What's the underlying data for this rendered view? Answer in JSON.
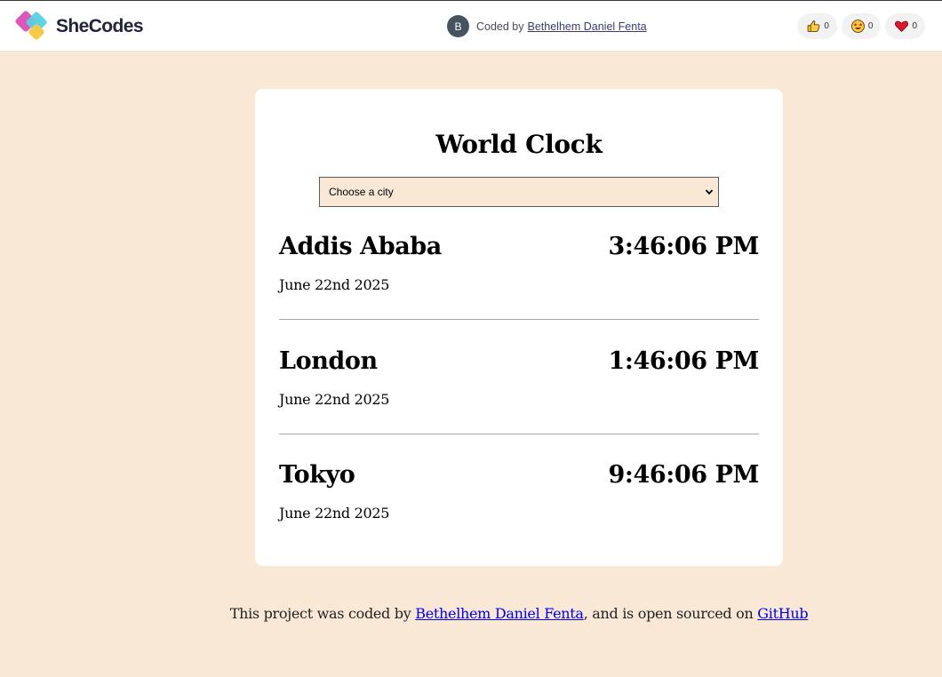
{
  "topbar": {
    "brand": "SheCodes",
    "credit": {
      "avatar_initial": "B",
      "prefix": "Coded by",
      "author": "Bethelhem Daniel Fenta"
    },
    "reactions": [
      {
        "icon": "thumbs-up-icon",
        "count": "0"
      },
      {
        "icon": "star-struck-icon",
        "count": "0"
      },
      {
        "icon": "heart-icon",
        "count": "0"
      }
    ]
  },
  "app": {
    "title": "World Clock",
    "select": {
      "selected": "Choose a city"
    },
    "cities": [
      {
        "name": "Addis Ababa",
        "time": "3:46:06 PM",
        "date": "June 22nd 2025"
      },
      {
        "name": "London",
        "time": "1:46:06 PM",
        "date": "June 22nd 2025"
      },
      {
        "name": "Tokyo",
        "time": "9:46:06 PM",
        "date": "June 22nd 2025"
      }
    ]
  },
  "footer": {
    "text_before": "This project was coded by ",
    "author_link": "Bethelhem Daniel Fenta",
    "text_middle": ", and is open sourced on ",
    "repo_link": "GitHub"
  },
  "colors": {
    "page_background": "#f9e8d6",
    "card_background": "#ffffff",
    "select_background": "#f9e8d6",
    "link": "#0000ee",
    "avatar": "#46545f",
    "heart": "#e0182d"
  }
}
